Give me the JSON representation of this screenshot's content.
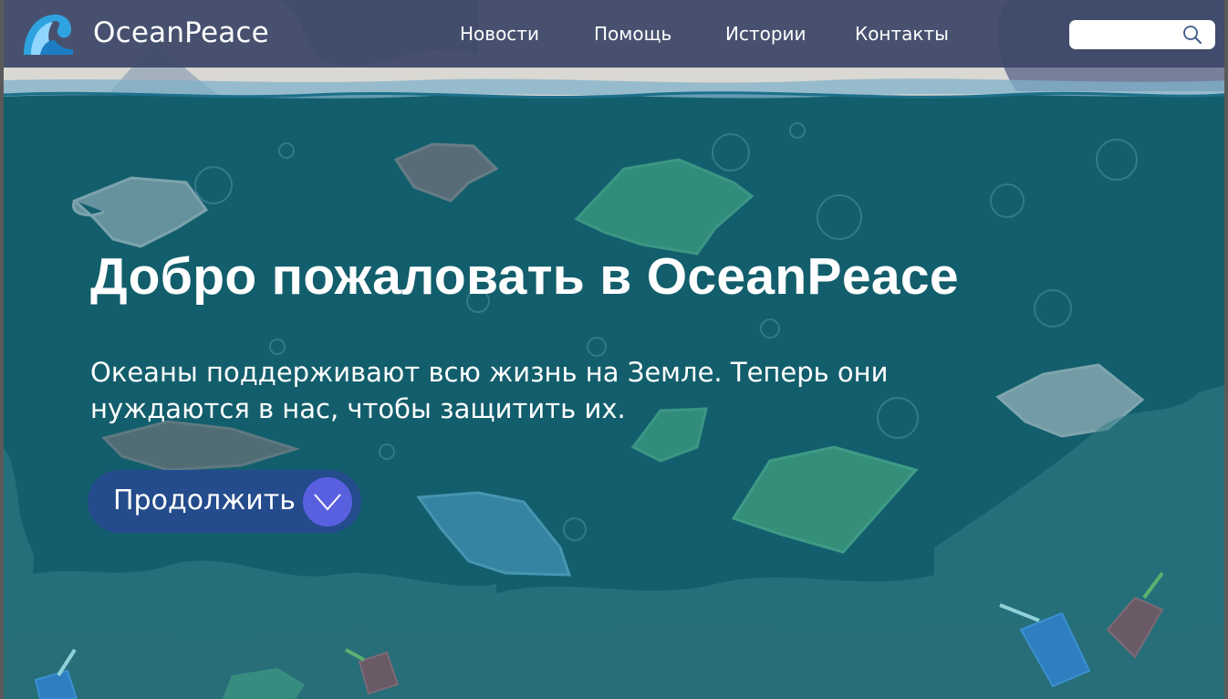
{
  "brand": {
    "name": "OceanPeace",
    "colors": {
      "header": "#3e4868",
      "ocean": "#115a68",
      "cta": "#244b8c",
      "cta_accent": "#5960e0"
    }
  },
  "nav": {
    "items": [
      {
        "label": "Новости"
      },
      {
        "label": "Помощь"
      },
      {
        "label": "Истории"
      },
      {
        "label": "Контакты"
      }
    ]
  },
  "search": {
    "value": "",
    "placeholder": "",
    "icon": "search-icon"
  },
  "hero": {
    "title": "Добро пожаловать в OceanPeace",
    "subtitle": "Океаны поддерживают всю жизнь на Земле. Теперь они нуждаются в нас, чтобы защитить их.",
    "cta_label": "Продолжить",
    "cta_icon": "chevron-down-icon"
  }
}
